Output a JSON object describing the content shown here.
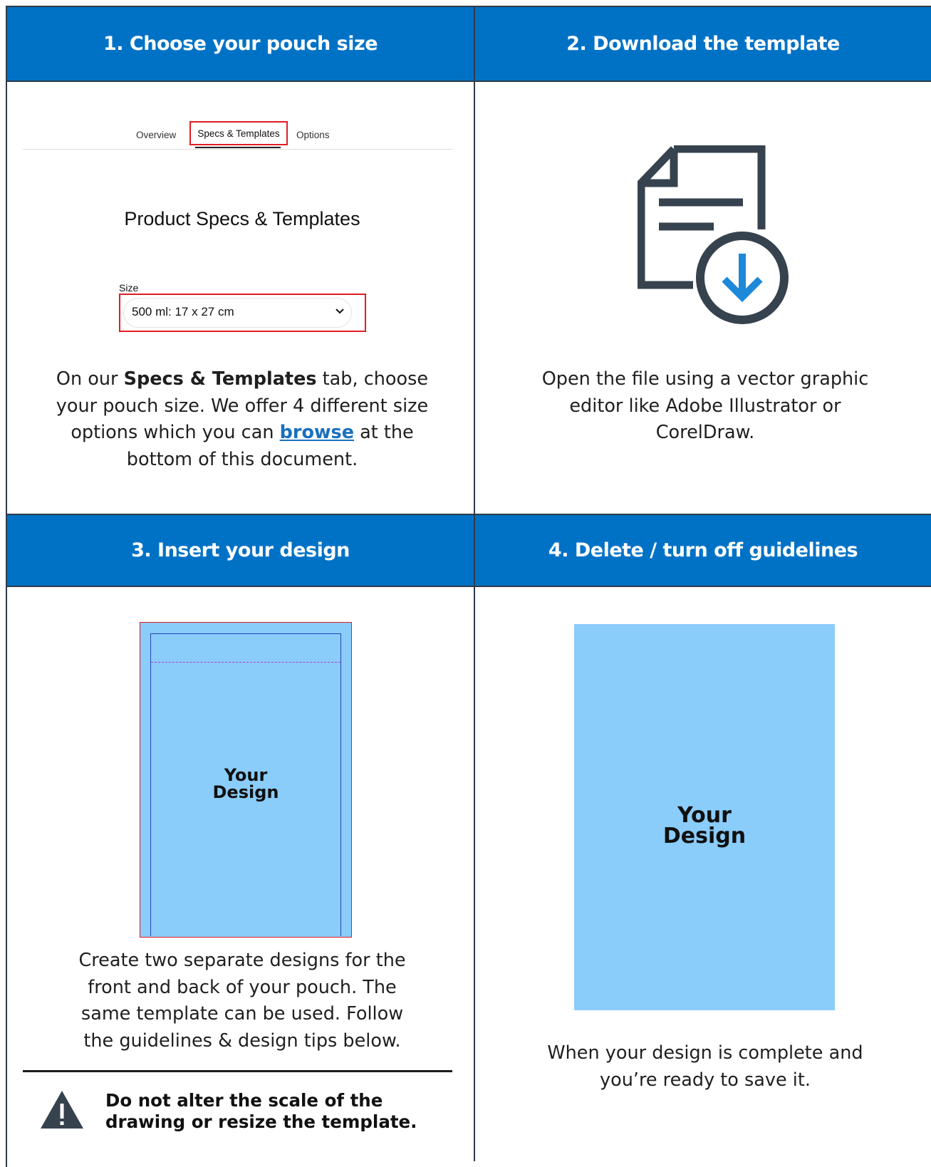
{
  "steps": [
    {
      "title": "1. Choose your pouch size"
    },
    {
      "title": "2. Download the template"
    },
    {
      "title": "3. Insert your design"
    },
    {
      "title": "4. Delete / turn off guidelines"
    }
  ],
  "step1": {
    "tabs": {
      "overview": "Overview",
      "specs": "Specs & Templates",
      "options": "Options"
    },
    "spec_title": "Product Specs & Templates",
    "size_label": "Size",
    "size_value": "500 ml: 17 x 27 cm",
    "text_pre": "On our ",
    "text_bold": "Specs & Templates",
    "text_mid": " tab, choose your pouch size. We offer 4 different size options which you can ",
    "text_link": "browse",
    "text_post": " at the bottom of this document."
  },
  "step2": {
    "icon": "file-download-icon",
    "text": "Open the file using a vector graphic editor like Adobe Illustrator or CorelDraw."
  },
  "step3": {
    "design_line1": "Your",
    "design_line2": "Design",
    "text": "Create two separate designs for the front and back of your pouch. The same template can be used. Follow the guidelines & design tips below.",
    "warning": "Do not alter the scale of the drawing or resize the template."
  },
  "step4": {
    "design_line1": "Your",
    "design_line2": "Design",
    "text": "When your design is complete and you’re ready to save it."
  },
  "colors": {
    "header_blue": "#0072c6",
    "design_blue": "#8accfa",
    "highlight_red": "#e11c24",
    "link_blue": "#1a6fc0"
  }
}
